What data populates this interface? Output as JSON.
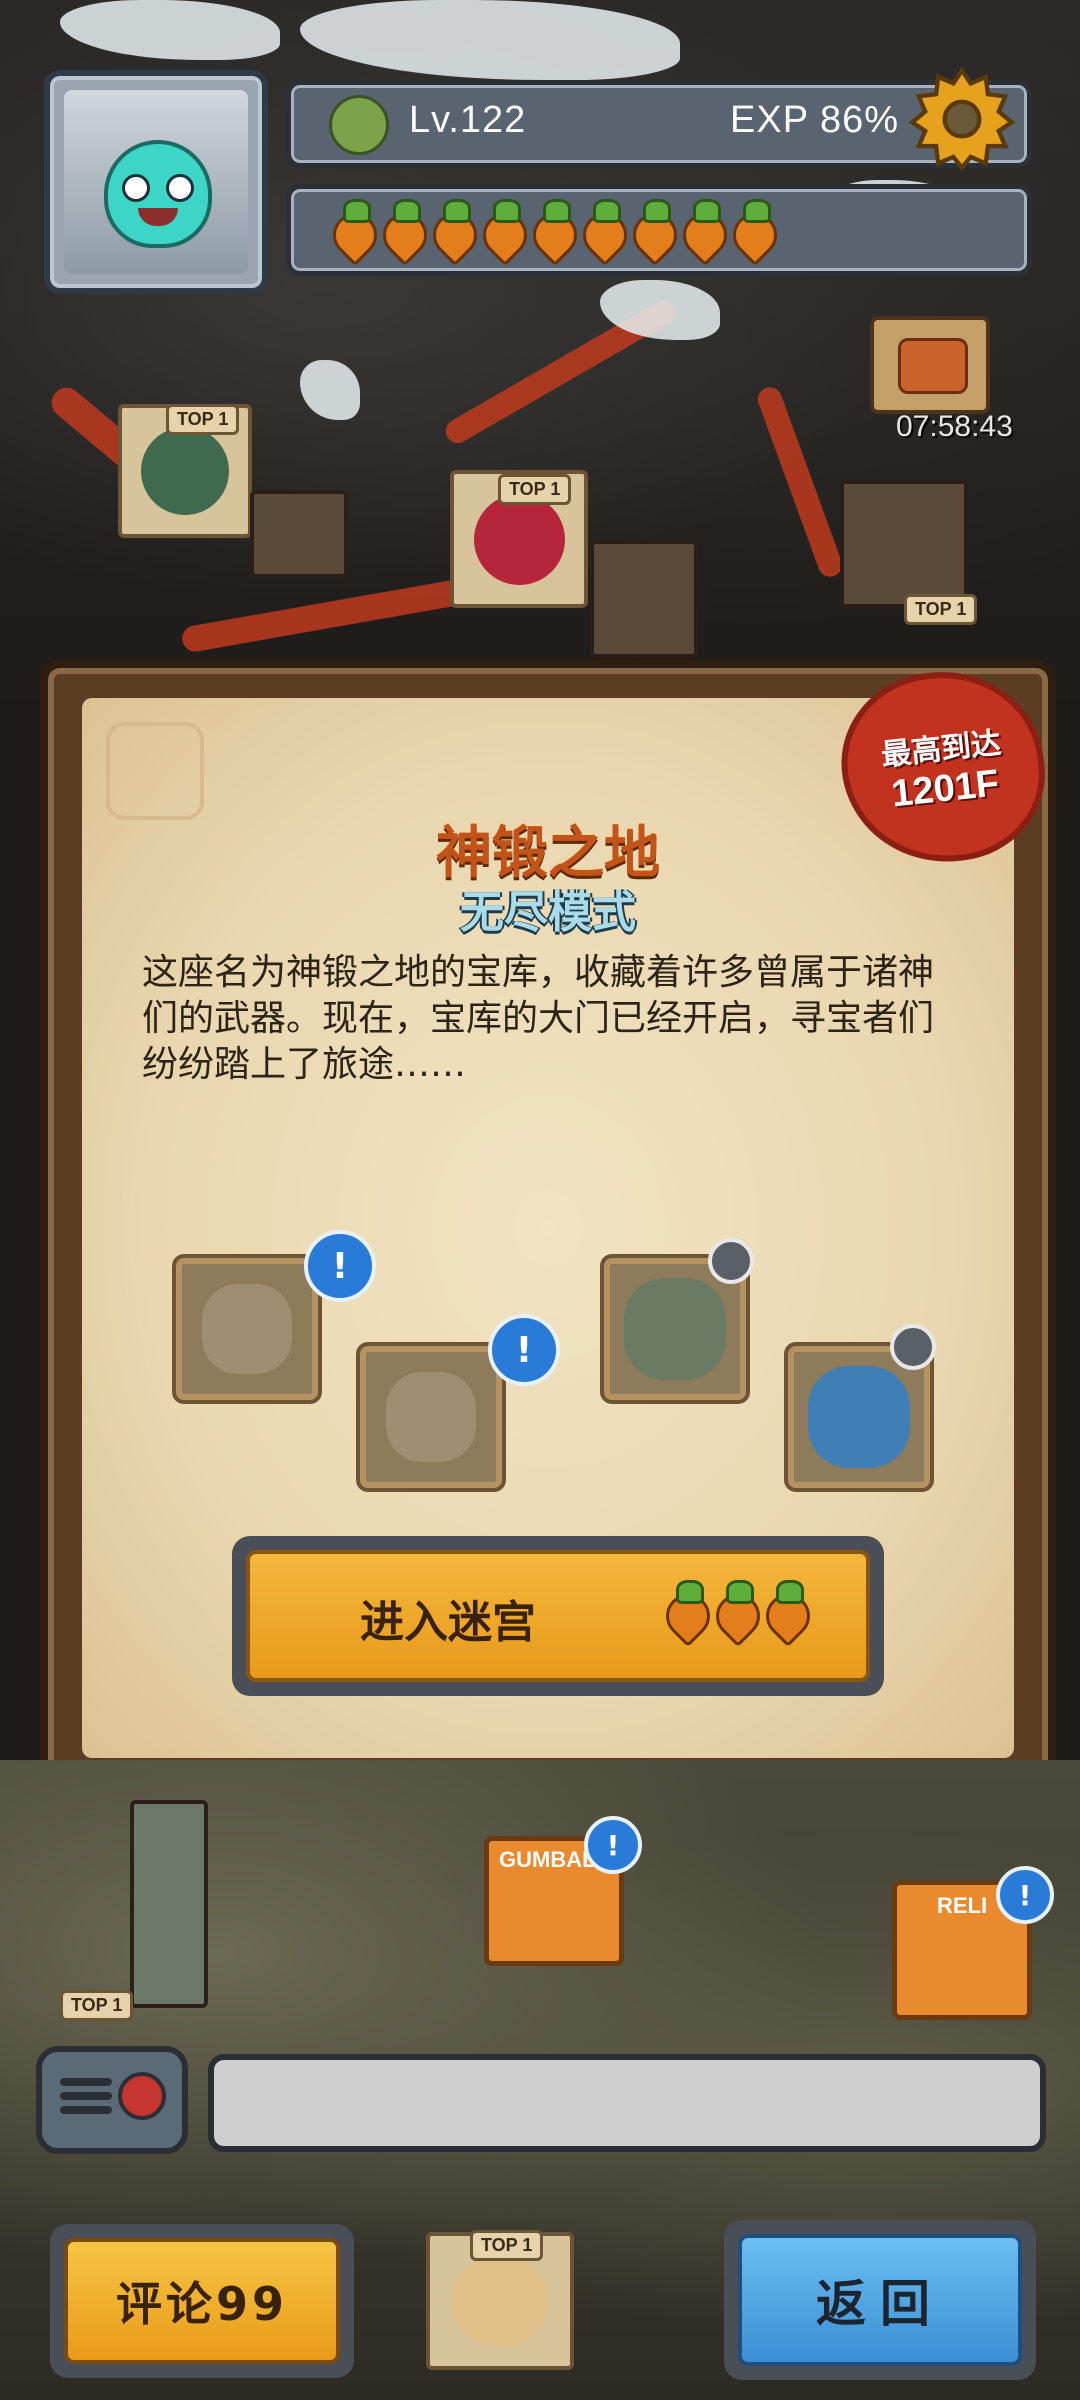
{
  "hud": {
    "level": "Lv.122",
    "exp": "EXP 86%",
    "carrot_count": 9,
    "timer": "07:58:43"
  },
  "map": {
    "top_badges": [
      "TOP 1",
      "TOP 1",
      "TOP 1",
      "TOP 1",
      "TOP 1"
    ],
    "signs": {
      "gumball": "GUMBALL",
      "relic": "RELI"
    }
  },
  "panel": {
    "title": "神锻之地",
    "subtitle": "无尽模式",
    "description": "这座名为神锻之地的宝库，收藏着许多曾属于诸神们的武器。现在，宝库的大门已经开启，寻宝者们纷纷踏上了旅途……",
    "seal_label": "最高到达",
    "seal_value": "1201F",
    "enter_button": "进入迷宫",
    "enter_cost_carrots": 3
  },
  "buttons": {
    "comments": "评论99",
    "back": "返回"
  },
  "colors": {
    "accent_orange": "#e99b19",
    "accent_blue": "#3c8fd3",
    "seal_red": "#c2331f",
    "title_orange": "#c4531a"
  }
}
